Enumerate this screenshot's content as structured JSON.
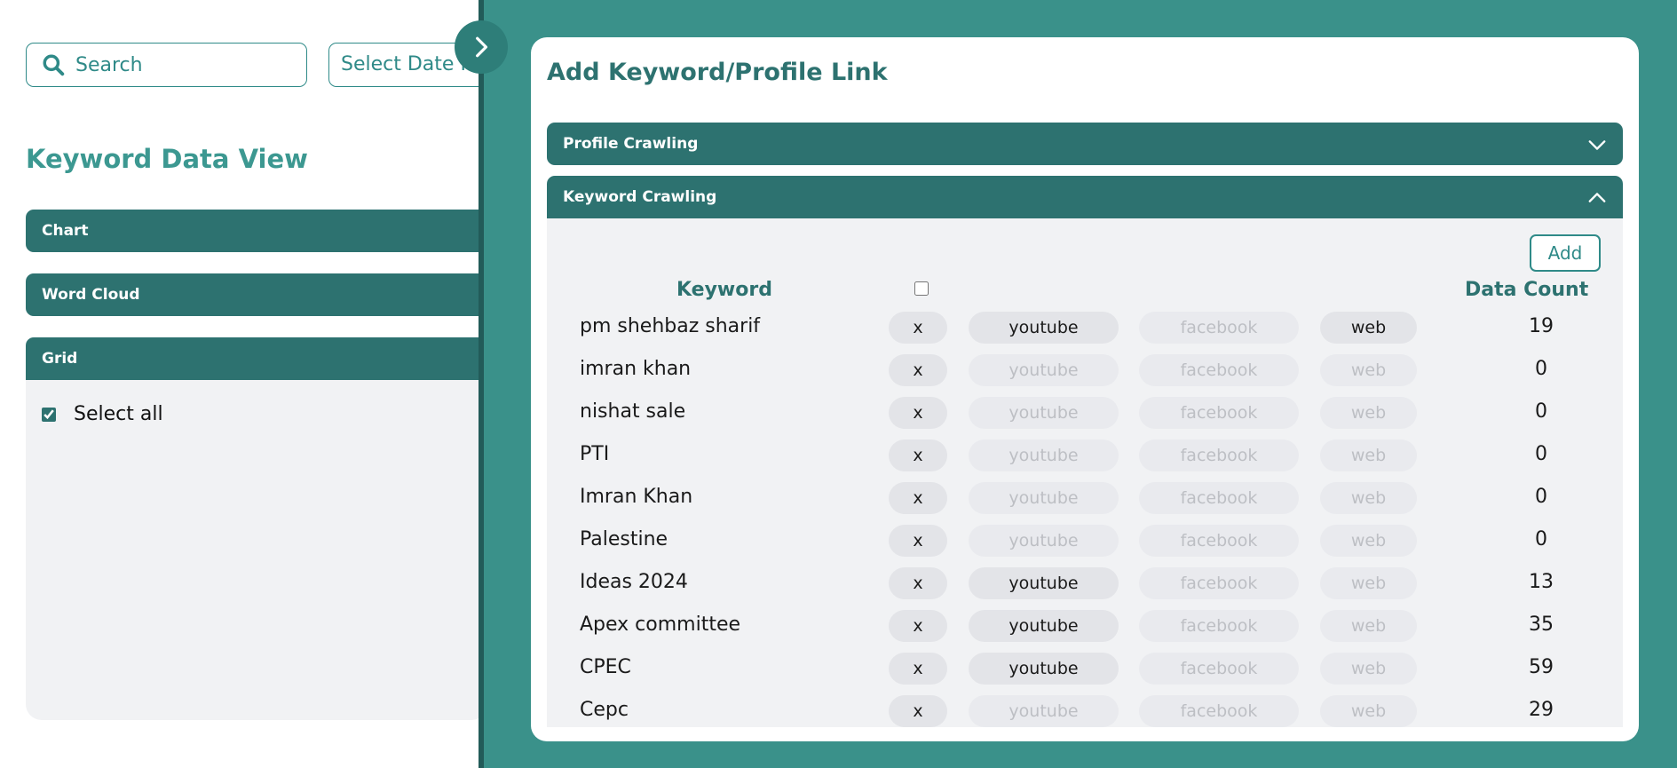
{
  "search": {
    "placeholder": "Search"
  },
  "date_button": {
    "label": "Select Date Range"
  },
  "page_title": "Keyword Data View",
  "accordions": {
    "chart": "Chart",
    "word_cloud": "Word Cloud",
    "grid": "Grid"
  },
  "grid": {
    "select_all_label": "Select all",
    "select_all_checked": true
  },
  "modal": {
    "title": "Add Keyword/Profile Link",
    "profile_section": "Profile Crawling",
    "keyword_section": "Keyword Crawling",
    "add_label": "Add",
    "columns": {
      "keyword": "Keyword",
      "data_count": "Data Count"
    }
  },
  "colors": {
    "primary": "#2d7270",
    "accent": "#3a918a",
    "panel": "#f1f2f4"
  },
  "icons": {
    "search": "search-icon",
    "toggle": "chevron-right-icon",
    "collapsed": "chevron-down-icon",
    "expanded": "chevron-up-icon"
  },
  "keywords": [
    {
      "keyword": "pm shehbaz sharif",
      "x": "x",
      "youtube": "youtube",
      "facebook": "facebook",
      "web": "web",
      "youtube_on": true,
      "facebook_on": false,
      "web_on": true,
      "count": "19"
    },
    {
      "keyword": "imran khan",
      "x": "x",
      "youtube": "youtube",
      "facebook": "facebook",
      "web": "web",
      "youtube_on": false,
      "facebook_on": false,
      "web_on": false,
      "count": "0"
    },
    {
      "keyword": "nishat sale",
      "x": "x",
      "youtube": "youtube",
      "facebook": "facebook",
      "web": "web",
      "youtube_on": false,
      "facebook_on": false,
      "web_on": false,
      "count": "0"
    },
    {
      "keyword": "PTI",
      "x": "x",
      "youtube": "youtube",
      "facebook": "facebook",
      "web": "web",
      "youtube_on": false,
      "facebook_on": false,
      "web_on": false,
      "count": "0"
    },
    {
      "keyword": "Imran Khan",
      "x": "x",
      "youtube": "youtube",
      "facebook": "facebook",
      "web": "web",
      "youtube_on": false,
      "facebook_on": false,
      "web_on": false,
      "count": "0"
    },
    {
      "keyword": "Palestine",
      "x": "x",
      "youtube": "youtube",
      "facebook": "facebook",
      "web": "web",
      "youtube_on": false,
      "facebook_on": false,
      "web_on": false,
      "count": "0"
    },
    {
      "keyword": "Ideas 2024",
      "x": "x",
      "youtube": "youtube",
      "facebook": "facebook",
      "web": "web",
      "youtube_on": true,
      "facebook_on": false,
      "web_on": false,
      "count": "13"
    },
    {
      "keyword": "Apex committee",
      "x": "x",
      "youtube": "youtube",
      "facebook": "facebook",
      "web": "web",
      "youtube_on": true,
      "facebook_on": false,
      "web_on": false,
      "count": "35"
    },
    {
      "keyword": "CPEC",
      "x": "x",
      "youtube": "youtube",
      "facebook": "facebook",
      "web": "web",
      "youtube_on": true,
      "facebook_on": false,
      "web_on": false,
      "count": "59"
    },
    {
      "keyword": "Cepc",
      "x": "x",
      "youtube": "youtube",
      "facebook": "facebook",
      "web": "web",
      "youtube_on": false,
      "facebook_on": false,
      "web_on": false,
      "count": "29"
    }
  ]
}
